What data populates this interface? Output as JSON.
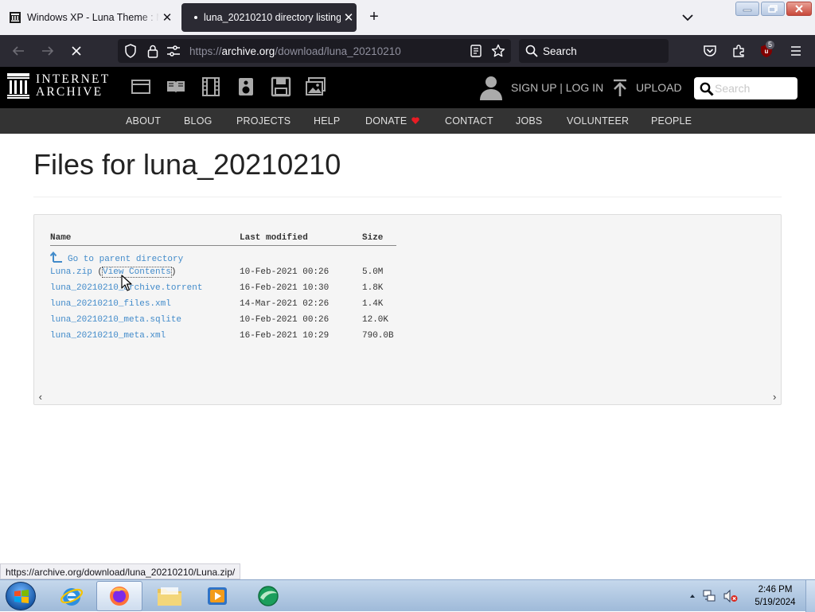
{
  "browser": {
    "tabs": [
      {
        "title": "Windows XP - Luna Theme : Mi",
        "active": false
      },
      {
        "title": "luna_20210210 directory listing",
        "active": true
      }
    ],
    "url_prefix": "https://",
    "url_host": "archive.org",
    "url_path": "/download/luna_20210210",
    "search_label": "Search",
    "extensions_badge": "5"
  },
  "ia_header": {
    "logo_line1": "INTERNET",
    "logo_line2": "ARCHIVE",
    "signup_login": "SIGN UP | LOG IN",
    "upload": "UPLOAD",
    "search_placeholder": "Search",
    "nav": [
      "ABOUT",
      "BLOG",
      "PROJECTS",
      "HELP",
      "DONATE",
      "CONTACT",
      "JOBS",
      "VOLUNTEER",
      "PEOPLE"
    ],
    "accent_color": "#e81c24"
  },
  "page": {
    "title": "Files for luna_20210210"
  },
  "listing": {
    "headers": {
      "name": "Name",
      "modified": "Last modified",
      "size": "Size"
    },
    "parent_link": "Go to parent directory",
    "rows": [
      {
        "name": "Luna.zip",
        "modified": "10-Feb-2021 00:26",
        "size": "5.0M",
        "view_open": " (",
        "view_contents": "View Contents",
        "view_close": ")"
      },
      {
        "name": "luna_20210210_archive.torrent",
        "modified": "16-Feb-2021 10:30",
        "size": "1.8K"
      },
      {
        "name": "luna_20210210_files.xml",
        "modified": "14-Mar-2021 02:26",
        "size": "1.4K"
      },
      {
        "name": "luna_20210210_meta.sqlite",
        "modified": "10-Feb-2021 00:26",
        "size": "12.0K"
      },
      {
        "name": "luna_20210210_meta.xml",
        "modified": "16-Feb-2021 10:29",
        "size": "790.0B"
      }
    ]
  },
  "status_bar": "https://archive.org/download/luna_20210210/Luna.zip/",
  "taskbar": {
    "time": "2:46 PM",
    "date": "5/19/2024"
  }
}
